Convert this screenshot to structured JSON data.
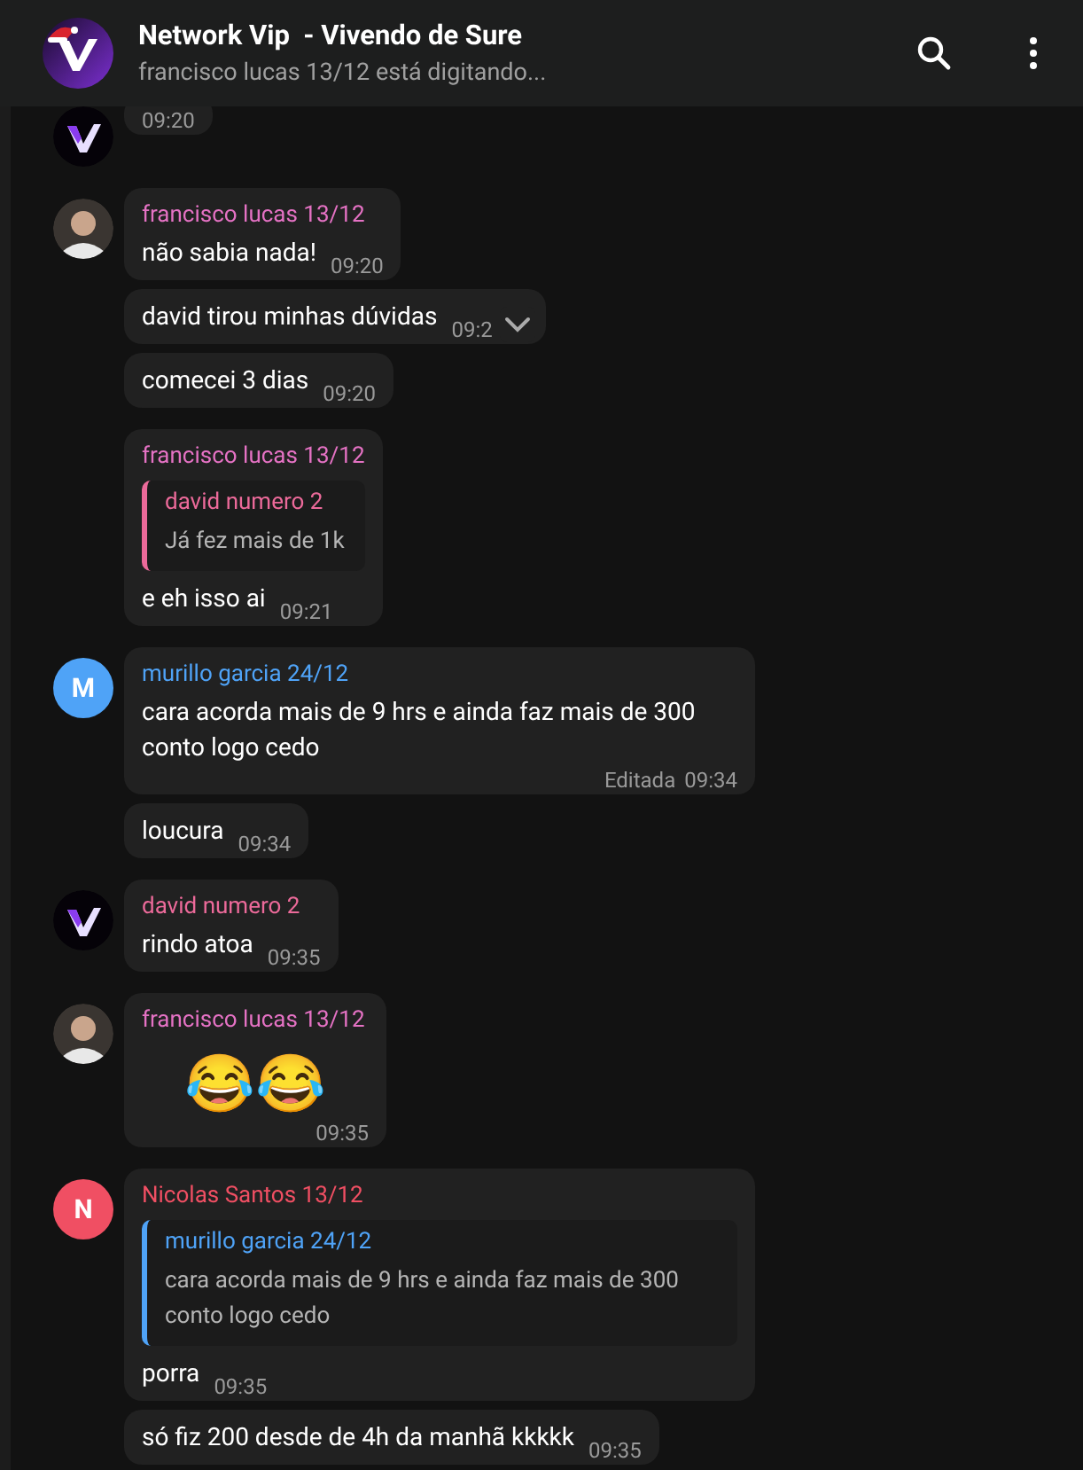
{
  "header": {
    "title": "Network Vip  - Vivendo de Sure",
    "status": "francisco lucas 13/12 está digitando..."
  },
  "groups": [
    {
      "avatar": {
        "kind": "logo"
      },
      "messages": [
        {
          "kind": "text",
          "time": "09:20"
        }
      ]
    },
    {
      "avatar": {
        "kind": "photo"
      },
      "sender": "francisco lucas 13/12",
      "color": "#e572c4",
      "messages": [
        {
          "kind": "text",
          "text": "não sabia nada!",
          "time": "09:20"
        },
        {
          "kind": "text",
          "text": "david tirou minhas dúvidas",
          "time": "09:2",
          "hovered": true
        },
        {
          "kind": "text",
          "text": "comecei 3 dias",
          "time": "09:20"
        }
      ]
    },
    {
      "avatar": {
        "kind": "none"
      },
      "sender": "francisco lucas 13/12",
      "color": "#e572c4",
      "messages": [
        {
          "kind": "text",
          "reply": {
            "name": "david numero 2",
            "text": "Já fez mais de 1k",
            "color": "#ec6a9a"
          },
          "text": "e eh isso ai",
          "time": "09:21"
        }
      ]
    },
    {
      "avatar": {
        "kind": "letter",
        "letter": "M",
        "color": "#4fa3f7"
      },
      "sender": "murillo garcia 24/12",
      "color": "#4fa3f7",
      "messages": [
        {
          "kind": "text",
          "text": "cara acorda mais de 9 hrs e ainda faz mais de 300 conto logo cedo",
          "time": "09:34",
          "edited": "Editada"
        },
        {
          "kind": "text",
          "text": "loucura",
          "time": "09:34"
        }
      ]
    },
    {
      "avatar": {
        "kind": "logo"
      },
      "sender": "david numero 2",
      "color": "#ec6a9a",
      "messages": [
        {
          "kind": "text",
          "text": "rindo atoa",
          "time": "09:35"
        }
      ]
    },
    {
      "avatar": {
        "kind": "photo"
      },
      "sender": "francisco lucas 13/12",
      "color": "#e572c4",
      "messages": [
        {
          "kind": "emoji",
          "text": "😂😂",
          "time": "09:35"
        }
      ]
    },
    {
      "avatar": {
        "kind": "letter",
        "letter": "N",
        "color": "#f04f63"
      },
      "sender": "Nicolas Santos 13/12",
      "color": "#f04f63",
      "messages": [
        {
          "kind": "text",
          "reply": {
            "name": "murillo garcia 24/12",
            "text": "cara acorda mais de 9 hrs e ainda faz mais de 300 conto logo cedo",
            "color": "#4fa3f7"
          },
          "text": "porra",
          "time": "09:35"
        },
        {
          "kind": "text",
          "text": "só fiz 200 desde de 4h da manhã kkkkk",
          "time": "09:35"
        }
      ]
    }
  ]
}
